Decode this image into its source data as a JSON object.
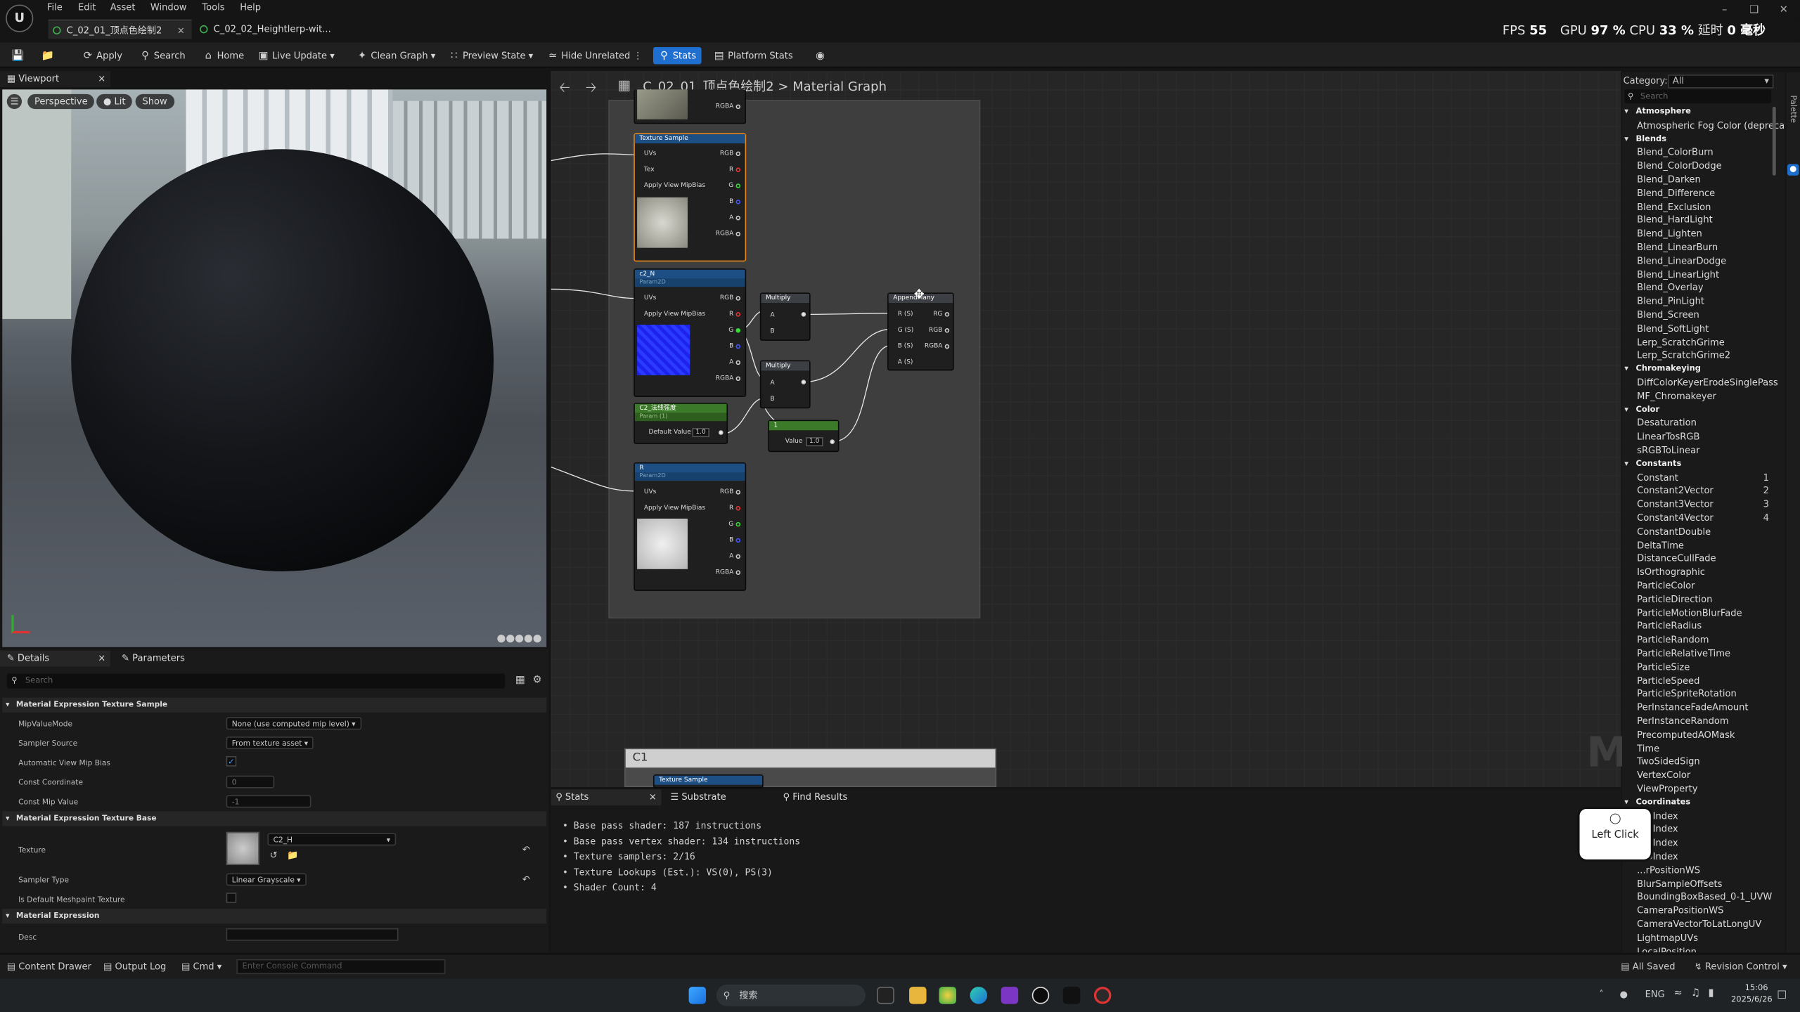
{
  "menu": {
    "items": [
      "File",
      "Edit",
      "Asset",
      "Window",
      "Tools",
      "Help"
    ]
  },
  "tabs": [
    {
      "label": "C_02_01_顶点色绘制2"
    },
    {
      "label": "C_02_02_Heightlerp-wit..."
    }
  ],
  "perf": {
    "fps_label": "FPS",
    "fps": "55",
    "gpu_label": "GPU",
    "gpu": "97 %",
    "cpu_label": "CPU",
    "cpu": "33 %",
    "latency_label": "延时",
    "latency": "0 毫秒"
  },
  "toolbar": {
    "apply": "Apply",
    "search": "Search",
    "home": "Home",
    "live_update": "Live Update",
    "clean_graph": "Clean Graph",
    "preview_state": "Preview State",
    "hide_unrelated": "Hide Unrelated",
    "stats": "Stats",
    "platform_stats": "Platform Stats"
  },
  "viewport": {
    "tab": "Viewport",
    "perspective": "Perspective",
    "lit": "Lit",
    "show": "Show"
  },
  "graph": {
    "breadcrumb_asset": "C_02_01_顶点色绘制2",
    "breadcrumb_sep": ">",
    "breadcrumb_graph": "Material Graph",
    "watermark": "M",
    "comment_c1": "C1",
    "nodes": {
      "top_rgba": "RGBA",
      "ts1_title": "Texture Sample",
      "ts1_uvs": "UVs",
      "ts1_tex": "Tex",
      "ts1_mip": "Apply View MipBias",
      "rgb": "RGB",
      "r": "R",
      "g": "G",
      "b": "B",
      "a": "A",
      "rgba": "RGBA",
      "p2_title": "c2_N",
      "p2_sub": "Param2D",
      "p3_title": "C2_法线强度",
      "p3_sub": "Param (1)",
      "default_value": "Default Value",
      "default_num": "1.0",
      "p4_title": "R",
      "p4_sub": "Param2D",
      "mult1": "Multiply",
      "mult2": "Multiply",
      "pa": "A",
      "pb": "B",
      "const_title": "1",
      "const_value": "Value",
      "const_num": "1.0",
      "append_title": "AppendMany",
      "ar": "R (S)",
      "ag": "G (S)",
      "ab": "B (S)",
      "aa": "A (S)",
      "org": "RG",
      "orgb": "RGB",
      "orgba": "RGBA",
      "c1_ts": "Texture Sample"
    }
  },
  "details": {
    "tab": "Details",
    "params_tab": "Parameters",
    "search_placeholder": "Search",
    "sec1": "Material Expression Texture Sample",
    "mip_mode_label": "MipValueMode",
    "mip_mode": "None (use computed mip level)",
    "sampler_source_label": "Sampler Source",
    "sampler_source": "From texture asset",
    "auto_mip_label": "Automatic View Mip Bias",
    "const_coord_label": "Const Coordinate",
    "const_coord": "0",
    "const_mip_label": "Const Mip Value",
    "const_mip": "-1",
    "sec2": "Material Expression Texture Base",
    "texture_label": "Texture",
    "texture": "C2_H",
    "sampler_type_label": "Sampler Type",
    "sampler_type": "Linear Grayscale",
    "meshpaint_label": "Is Default Meshpaint Texture",
    "sec3": "Material Expression",
    "desc_label": "Desc"
  },
  "stats": {
    "tab": "Stats",
    "substrate_tab": "Substrate",
    "find_tab": "Find Results",
    "lines": [
      "Base pass shader: 187 instructions",
      "Base pass vertex shader: 134 instructions",
      "Texture samplers: 2/16",
      "Texture Lookups (Est.): VS(0), PS(3)",
      "Shader Count: 4"
    ]
  },
  "palette": {
    "category_label": "Category:",
    "category": "All",
    "search_placeholder": "Search",
    "side_label": "Palette",
    "items": [
      {
        "t": "cat",
        "l": "Atmosphere"
      },
      {
        "t": "i",
        "l": "Atmospheric Fog Color (deprecat"
      },
      {
        "t": "cat",
        "l": "Blends"
      },
      {
        "t": "i",
        "l": "Blend_ColorBurn"
      },
      {
        "t": "i",
        "l": "Blend_ColorDodge"
      },
      {
        "t": "i",
        "l": "Blend_Darken"
      },
      {
        "t": "i",
        "l": "Blend_Difference"
      },
      {
        "t": "i",
        "l": "Blend_Exclusion"
      },
      {
        "t": "i",
        "l": "Blend_HardLight"
      },
      {
        "t": "i",
        "l": "Blend_Lighten"
      },
      {
        "t": "i",
        "l": "Blend_LinearBurn"
      },
      {
        "t": "i",
        "l": "Blend_LinearDodge"
      },
      {
        "t": "i",
        "l": "Blend_LinearLight"
      },
      {
        "t": "i",
        "l": "Blend_Overlay"
      },
      {
        "t": "i",
        "l": "Blend_PinLight"
      },
      {
        "t": "i",
        "l": "Blend_Screen"
      },
      {
        "t": "i",
        "l": "Blend_SoftLight"
      },
      {
        "t": "i",
        "l": "Lerp_ScratchGrime"
      },
      {
        "t": "i",
        "l": "Lerp_ScratchGrime2"
      },
      {
        "t": "cat",
        "l": "Chromakeying"
      },
      {
        "t": "i",
        "l": "DiffColorKeyerErodeSinglePass"
      },
      {
        "t": "i",
        "l": "MF_Chromakeyer"
      },
      {
        "t": "cat",
        "l": "Color"
      },
      {
        "t": "i",
        "l": "Desaturation"
      },
      {
        "t": "i",
        "l": "LinearTosRGB"
      },
      {
        "t": "i",
        "l": "sRGBToLinear"
      },
      {
        "t": "cat",
        "l": "Constants"
      },
      {
        "t": "i",
        "l": "Constant",
        "n": "1"
      },
      {
        "t": "i",
        "l": "Constant2Vector",
        "n": "2"
      },
      {
        "t": "i",
        "l": "Constant3Vector",
        "n": "3"
      },
      {
        "t": "i",
        "l": "Constant4Vector",
        "n": "4"
      },
      {
        "t": "i",
        "l": "ConstantDouble"
      },
      {
        "t": "i",
        "l": "DeltaTime"
      },
      {
        "t": "i",
        "l": "DistanceCullFade"
      },
      {
        "t": "i",
        "l": "IsOrthographic"
      },
      {
        "t": "i",
        "l": "ParticleColor"
      },
      {
        "t": "i",
        "l": "ParticleDirection"
      },
      {
        "t": "i",
        "l": "ParticleMotionBlurFade"
      },
      {
        "t": "i",
        "l": "ParticleRadius"
      },
      {
        "t": "i",
        "l": "ParticleRandom"
      },
      {
        "t": "i",
        "l": "ParticleRelativeTime"
      },
      {
        "t": "i",
        "l": "ParticleSize"
      },
      {
        "t": "i",
        "l": "ParticleSpeed"
      },
      {
        "t": "i",
        "l": "ParticleSpriteRotation"
      },
      {
        "t": "i",
        "l": "PerInstanceFadeAmount"
      },
      {
        "t": "i",
        "l": "PerInstanceRandom"
      },
      {
        "t": "i",
        "l": "PrecomputedAOMask"
      },
      {
        "t": "i",
        "l": "Time"
      },
      {
        "t": "i",
        "l": "TwoSidedSign"
      },
      {
        "t": "i",
        "l": "VertexColor"
      },
      {
        "t": "i",
        "l": "ViewProperty"
      },
      {
        "t": "cat",
        "l": "Coordinates"
      },
      {
        "t": "i",
        "l": "...DIndex"
      },
      {
        "t": "i",
        "l": "...DIndex"
      },
      {
        "t": "i",
        "l": "...DIndex"
      },
      {
        "t": "i",
        "l": "...DIndex"
      },
      {
        "t": "i",
        "l": "...rPositionWS"
      },
      {
        "t": "i",
        "l": "BlurSampleOffsets"
      },
      {
        "t": "i",
        "l": "BoundingBoxBased_0-1_UVW"
      },
      {
        "t": "i",
        "l": "CameraPositionWS"
      },
      {
        "t": "i",
        "l": "CameraVectorToLatLongUV"
      },
      {
        "t": "i",
        "l": "LightmapUVs"
      },
      {
        "t": "i",
        "l": "LocalPosition"
      }
    ]
  },
  "toast": {
    "label": "Left Click"
  },
  "statusbar": {
    "content_drawer": "Content Drawer",
    "output_log": "Output Log",
    "cmd": "Cmd",
    "console_placeholder": "Enter Console Command",
    "saved": "All Saved",
    "revision": "Revision Control"
  },
  "taskbar": {
    "search": "搜索",
    "lang": "ENG",
    "time": "15:06",
    "date": "2025/6/26"
  },
  "colors": {
    "accent": "#1f6fd1",
    "param_header": "#1d4e84",
    "const_header": "#3b7a28"
  }
}
